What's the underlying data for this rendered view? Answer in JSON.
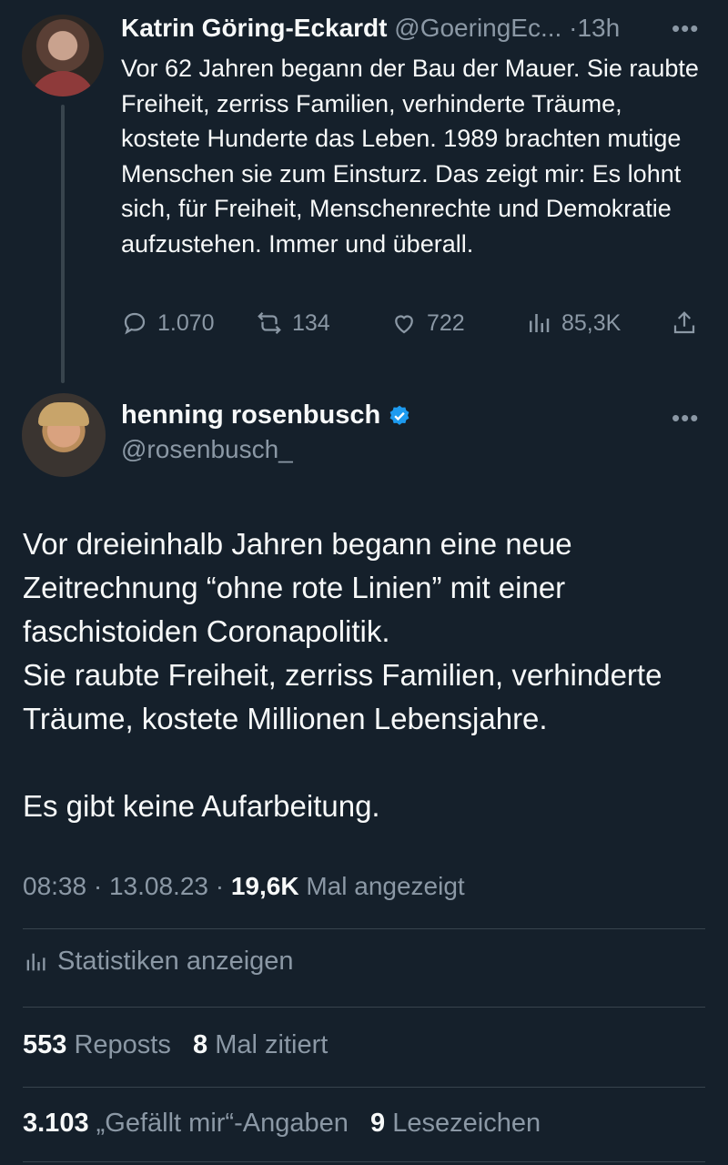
{
  "parent_tweet": {
    "author_name": "Katrin Göring-Eckardt",
    "author_handle": "@GoeringEc...",
    "separator": "·",
    "time": "13h",
    "text": "Vor 62 Jahren begann der Bau der Mauer. Sie raubte Freiheit, zerriss Familien, verhinderte Träume, kostete Hunderte das Leben. 1989 brachten mutige Menschen sie zum Einsturz. Das zeigt mir: Es lohnt sich, für Freiheit, Menschenrechte und Demokratie aufzustehen. Immer und überall.",
    "replies": "1.070",
    "reposts": "134",
    "likes": "722",
    "views": "85,3K",
    "more_icon": "more-dots-icon"
  },
  "tweet": {
    "author_name": "henning rosenbusch",
    "author_handle": "@rosenbusch_",
    "verified": true,
    "text": "Vor dreieinhalb Jahren begann eine neue Zeitrechnung “ohne rote Linien” mit einer faschistoiden Coronapolitik.\nSie raubte Freiheit, zerriss Familien, verhinderte Träume, kostete Millionen Lebensjahre.\n\nEs gibt keine Aufarbeitung.",
    "time": "08:38",
    "date": "13.08.23",
    "view_count": "19,6K",
    "view_label": "Mal angezeigt",
    "stats_link": "Statistiken anzeigen",
    "reposts_count": "553",
    "reposts_label": "Reposts",
    "quotes_count": "8",
    "quotes_label": "Mal zitiert",
    "likes_count": "3.103",
    "likes_label": "„Gefällt mir“-Angaben",
    "bookmarks_count": "9",
    "bookmarks_label": "Lesezeichen"
  },
  "colors": {
    "background": "#15202b",
    "text": "#f7f9f9",
    "muted": "#8b98a5",
    "divider": "#38444d",
    "verified": "#1d9bf0"
  }
}
